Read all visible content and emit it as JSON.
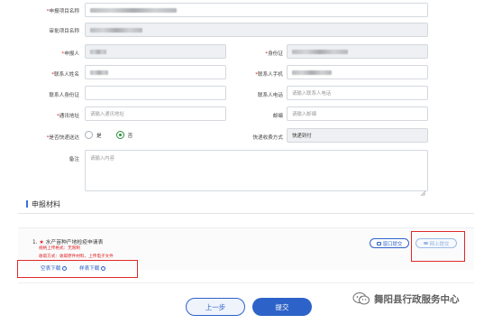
{
  "form": {
    "project_name": {
      "label": "申报项目名称",
      "required": true
    },
    "approval_name": {
      "label": "审批项目名称",
      "required": false
    },
    "applicant": {
      "label": "申报人",
      "required": true
    },
    "id_card": {
      "label": "身份证",
      "required": true
    },
    "contact_name": {
      "label": "联系人姓名",
      "required": true
    },
    "contact_mobile": {
      "label": "联系人手机",
      "required": true
    },
    "contact_id": {
      "label": "联系人身份证",
      "required": false
    },
    "contact_phone": {
      "label": "联系人电话",
      "required": false,
      "placeholder": "请输入联系人电话"
    },
    "address": {
      "label": "通讯地址",
      "required": true,
      "placeholder": "请输入通讯地址"
    },
    "postcode": {
      "label": "邮编",
      "required": false,
      "placeholder": "请输入邮编"
    },
    "express": {
      "label": "是否快递送达",
      "required": true,
      "option_yes": "是",
      "option_no": "否",
      "selected": "否"
    },
    "express_method": {
      "label": "快递收费方式",
      "value": "快递到付"
    },
    "remarks": {
      "label": "备注",
      "placeholder": "请输入内容"
    }
  },
  "materials": {
    "section_title": "申报材料",
    "item": {
      "index": "1.",
      "title": "水产苗种产地检疫申请表",
      "note1": "规格上传格式：无限制",
      "note2": "收取方式：收取原件材料，上传电子文件",
      "window_submit_label": "窗口提交",
      "online_submit_label": "网上提交",
      "blank_download_label": "空表下载",
      "sample_download_label": "样表下载"
    }
  },
  "nav": {
    "prev_label": "上一步",
    "submit_label": "提交"
  },
  "watermark": {
    "text": "舞阳县行政服务中心"
  },
  "colors": {
    "accent": "#2d63c8",
    "required": "#e02020",
    "highlight_box": "#e02828",
    "radio_selected": "#2a8f3a"
  }
}
